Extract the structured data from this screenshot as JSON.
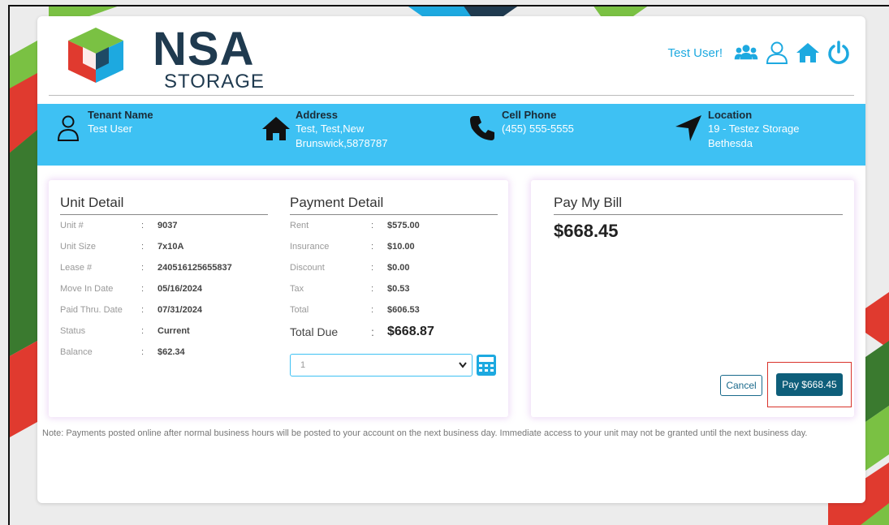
{
  "brand": {
    "name": "NSA",
    "subtitle": "STORAGE"
  },
  "header": {
    "greeting": "Test User!",
    "icons": [
      "users-icon",
      "user-icon",
      "home-icon",
      "power-icon"
    ]
  },
  "tenant": {
    "name_label": "Tenant Name",
    "name_value": "Test User",
    "address_label": "Address",
    "address_line1": "Test, Test,New",
    "address_line2": "Brunswick,5878787",
    "phone_label": "Cell Phone",
    "phone_value": "(455) 555-5555",
    "location_label": "Location",
    "location_line1": "19 - Testez Storage",
    "location_line2": "Bethesda"
  },
  "unit_detail": {
    "title": "Unit Detail",
    "rows": [
      {
        "label": "Unit #",
        "value": "9037"
      },
      {
        "label": "Unit Size",
        "value": "7x10A"
      },
      {
        "label": "Lease #",
        "value": "240516125655837"
      },
      {
        "label": "Move In Date",
        "value": "05/16/2024"
      },
      {
        "label": "Paid Thru. Date",
        "value": "07/31/2024"
      },
      {
        "label": "Status",
        "value": "Current"
      },
      {
        "label": "Balance",
        "value": "$62.34"
      }
    ]
  },
  "payment_detail": {
    "title": "Payment Detail",
    "rows": [
      {
        "label": "Rent",
        "value": "$575.00"
      },
      {
        "label": "Insurance",
        "value": "$10.00"
      },
      {
        "label": "Discount",
        "value": "$0.00"
      },
      {
        "label": "Tax",
        "value": "$0.53"
      },
      {
        "label": "Total",
        "value": "$606.53"
      }
    ],
    "total_due_label": "Total Due",
    "total_due_value": "$668.87",
    "months_selected": "1"
  },
  "pay_bill": {
    "title": "Pay My Bill",
    "amount": "$668.45",
    "cancel_label": "Cancel",
    "pay_label": "Pay $668.45"
  },
  "note": "Note: Payments posted online after normal business hours will be posted to your account on the next business day. Immediate access to your unit may not be granted until the next business day.",
  "colors": {
    "accent": "#3ec1f3",
    "primary_button": "#0e5e7a",
    "highlight": "#d9332b",
    "brand_green": "#7ac143",
    "brand_red": "#e03a2f",
    "brand_blue": "#1da9e0"
  }
}
